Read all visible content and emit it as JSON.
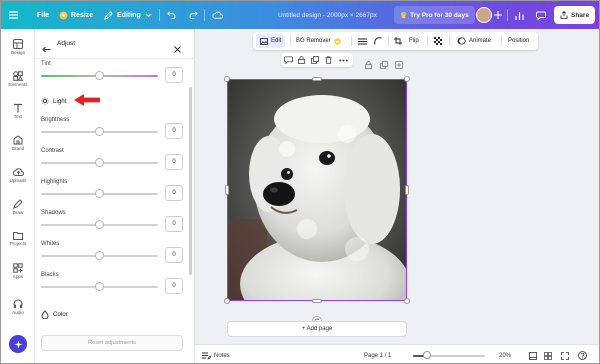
{
  "topbar": {
    "file": "File",
    "resize": "Resize",
    "editing": "Editing",
    "title": "Untitled design - 2000px × 2667px",
    "try_pro": "Try Pro for 30 days",
    "share": "Share"
  },
  "rail": {
    "items": [
      {
        "label": "Design",
        "icon": "design-icon"
      },
      {
        "label": "Elements",
        "icon": "elements-icon"
      },
      {
        "label": "Text",
        "icon": "text-icon"
      },
      {
        "label": "Brand",
        "icon": "brand-icon"
      },
      {
        "label": "Uploads",
        "icon": "uploads-icon"
      },
      {
        "label": "Draw",
        "icon": "draw-icon"
      },
      {
        "label": "Projects",
        "icon": "projects-icon"
      },
      {
        "label": "Apps",
        "icon": "apps-icon"
      },
      {
        "label": "Audio",
        "icon": "audio-icon"
      }
    ]
  },
  "panel": {
    "title": "Adjust",
    "tint": {
      "label": "Tint",
      "value": "0"
    },
    "light_section": "Light",
    "sliders": [
      {
        "label": "Brightness",
        "value": "0"
      },
      {
        "label": "Contrast",
        "value": "0"
      },
      {
        "label": "Highlights",
        "value": "0"
      },
      {
        "label": "Shadows",
        "value": "0"
      },
      {
        "label": "Whites",
        "value": "0"
      },
      {
        "label": "Blacks",
        "value": "0"
      }
    ],
    "color_section": "Color",
    "reset": "Reset adjustments"
  },
  "toolbar": {
    "edit": "Edit",
    "bg_remover": "BG Remover",
    "flip": "Flip",
    "animate": "Animate",
    "position": "Position"
  },
  "canvas": {
    "add_page": "+ Add page"
  },
  "bottombar": {
    "notes": "Notes",
    "page": "Page 1 / 1",
    "zoom": "20%",
    "zoom_fraction": 0.2
  },
  "colors": {
    "accent": "#8b3dff",
    "pointer_arrow": "#e02424"
  }
}
